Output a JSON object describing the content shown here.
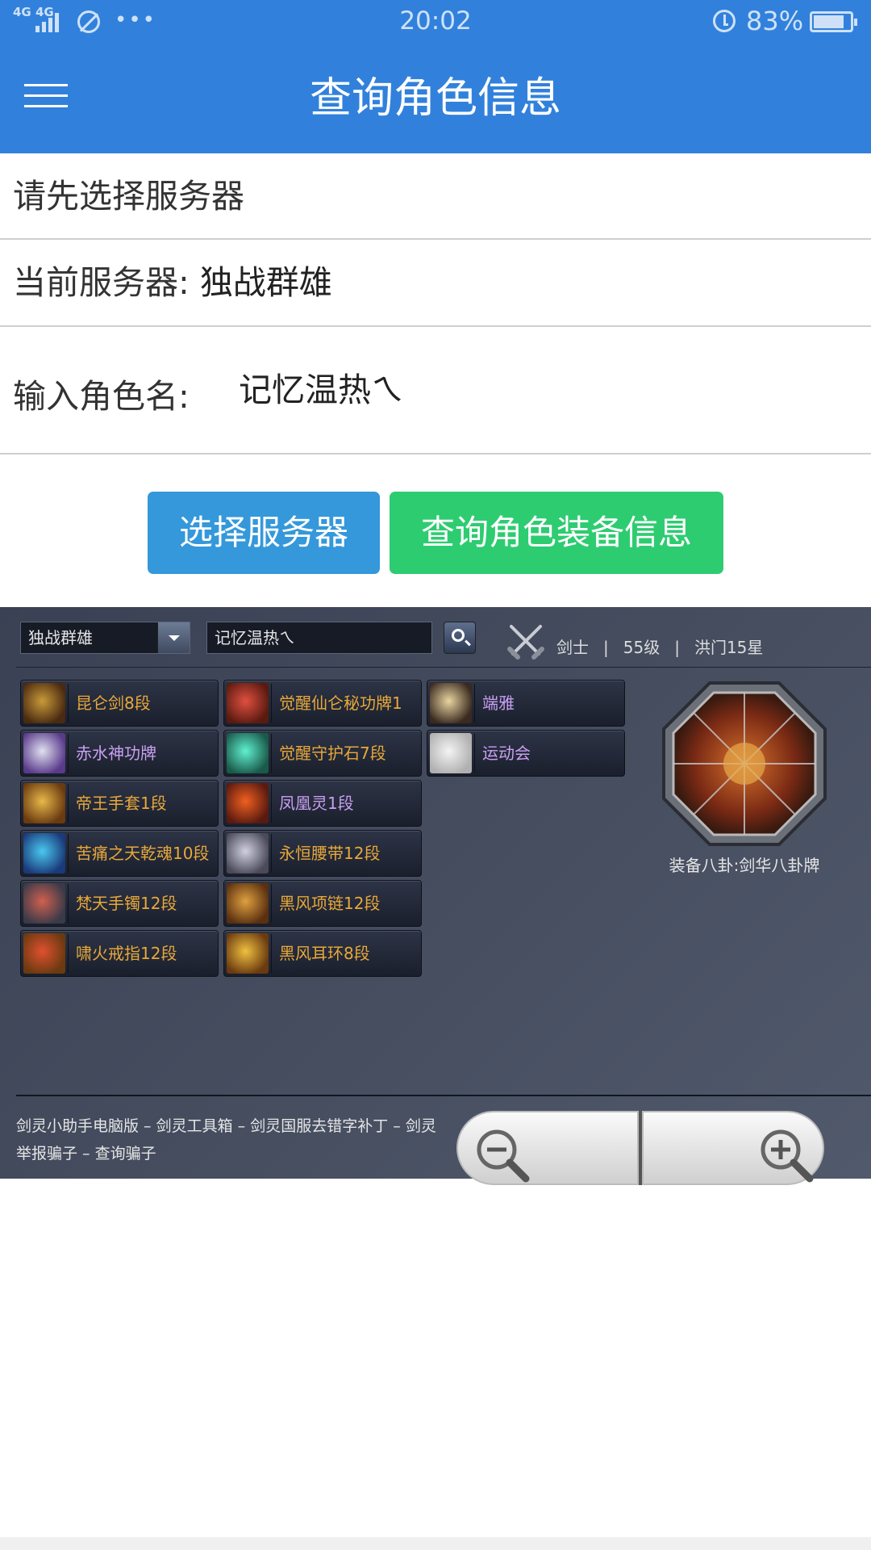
{
  "status": {
    "signal": "4G 4G",
    "time": "20:02",
    "battery_pct": "83%",
    "battery_level": 0.83,
    "dots": "•••"
  },
  "appbar": {
    "title": "查询角色信息"
  },
  "form": {
    "server_prompt": "请先选择服务器",
    "current_server_label": "当前服务器: ",
    "current_server": "独战群雄",
    "name_label": "输入角色名:",
    "name_value": "记忆温热ㄟ"
  },
  "buttons": {
    "select_server": "选择服务器",
    "query": "查询角色装备信息"
  },
  "web": {
    "server_select": "独战群雄",
    "name_box": "记忆温热ㄟ",
    "class": "剑士",
    "divider": "|",
    "level": "55级",
    "rank": "洪门15星",
    "items_col1": [
      {
        "name": "昆仑剑8段",
        "color": "gold",
        "icon": "sword-icon"
      },
      {
        "name": "赤水神功牌",
        "color": "purple",
        "icon": "scroll-icon"
      },
      {
        "name": "帝王手套1段",
        "color": "gold",
        "icon": "glove-icon"
      },
      {
        "name": "苦痛之天乾魂10段",
        "color": "gold",
        "icon": "soul-icon"
      },
      {
        "name": "梵天手镯12段",
        "color": "gold",
        "icon": "bracelet-icon"
      },
      {
        "name": "啸火戒指12段",
        "color": "gold",
        "icon": "ring-icon"
      }
    ],
    "items_col2": [
      {
        "name": "觉醒仙仑秘功牌1",
        "color": "gold",
        "icon": "badge-icon"
      },
      {
        "name": "觉醒守护石7段",
        "color": "gold",
        "icon": "gem-icon"
      },
      {
        "name": "凤凰灵1段",
        "color": "purple",
        "icon": "orb-icon"
      },
      {
        "name": "永恒腰带12段",
        "color": "gold",
        "icon": "belt-icon"
      },
      {
        "name": "黑风项链12段",
        "color": "gold",
        "icon": "necklace-icon"
      },
      {
        "name": "黑风耳环8段",
        "color": "gold",
        "icon": "earring-icon"
      }
    ],
    "items_col3": [
      {
        "name": "端雅",
        "color": "purple",
        "icon": "hair-icon"
      },
      {
        "name": "运动会",
        "color": "purple",
        "icon": "shirt-icon"
      }
    ],
    "bagua_caption": "装备八卦:剑华八卦牌",
    "footer_links": [
      "剑灵小助手电脑版",
      "剑灵工具箱",
      "剑灵国服去错字补丁",
      "剑灵",
      "举报骗子",
      "查询骗子"
    ],
    "footer_sep": " – "
  },
  "colors": {
    "primary": "#3181dc",
    "btn_blue": "#3498db",
    "btn_green": "#2ecc71",
    "gold": "#e8a83a",
    "purple": "#c9a0f2",
    "panel": "#464e60"
  }
}
